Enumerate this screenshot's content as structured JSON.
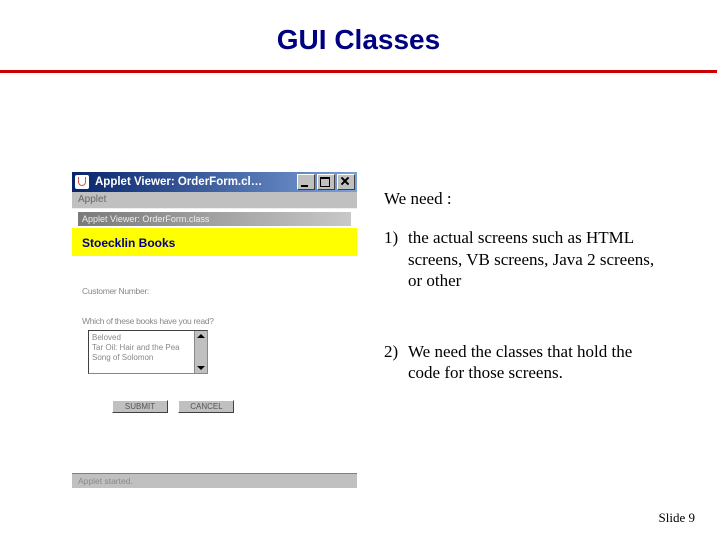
{
  "title": "GUI Classes",
  "footer": "Slide  9",
  "text": {
    "lead": "We need :",
    "items": [
      {
        "num": "1)",
        "body": "the actual screens such as HTML screens, VB screens,  Java 2 screens, or other"
      },
      {
        "num": "2)",
        "body": "We need the classes that hold the code for those screens."
      }
    ]
  },
  "applet": {
    "outer_title": "Applet Viewer: OrderForm.cl…",
    "menu": "Applet",
    "inner_title": "Applet Viewer: OrderForm.class",
    "brand": "Stoecklin Books",
    "customer_label": "Customer Number:",
    "list_label": "Which of these books have you read?",
    "list_items": [
      "Beloved",
      "Tar Oil: Hair and the Pea",
      "Song of Solomon"
    ],
    "buttons": {
      "submit": "SUBMIT",
      "cancel": "CANCEL"
    },
    "status": "Applet started."
  }
}
